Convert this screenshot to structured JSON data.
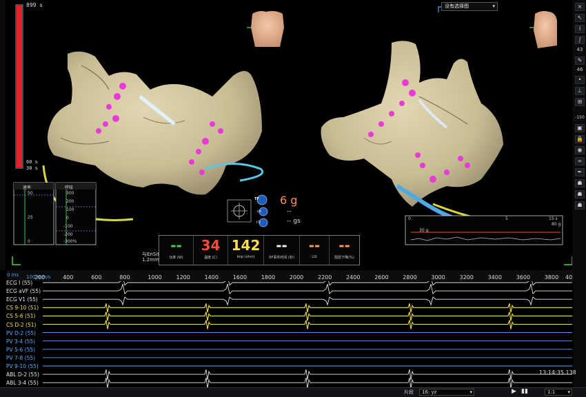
{
  "timer": {
    "value": "899 s",
    "sixty": "60 s",
    "thirty": "30 s"
  },
  "map_select": {
    "value": "没有选择图"
  },
  "zoom": {
    "value": "43"
  },
  "toolbar_numbers": {
    "n46": "46",
    "n150": "-150"
  },
  "resp_panel": {
    "title_left": "速率",
    "title_right": "呼吸",
    "left_ticks": [
      "50",
      "25",
      "0"
    ],
    "right_ticks": [
      "300",
      "200",
      "100",
      "0",
      "-100",
      "-200",
      "-300%"
    ]
  },
  "contact": {
    "force": "6 g",
    "dash1": "--",
    "dash2": "-- gs",
    "tf": "TF",
    "lm": "LM",
    "fti": "FTI"
  },
  "distance": {
    "line1": "与EnSite表面的距离",
    "line2": "1.2mm"
  },
  "rf": [
    {
      "value": "--",
      "caption": "功率 (W)",
      "color": "#4cd04c"
    },
    {
      "value": "34",
      "caption": "温度 (C)",
      "color": "#ff4a3a"
    },
    {
      "value": "142",
      "caption": "Imp (ohm)",
      "color": "#ffe04a"
    },
    {
      "value": "--",
      "caption": "RF事件时间 (秒)",
      "color": "#f0f0f0"
    },
    {
      "value": "--",
      "caption": "LSI",
      "color": "#ff9c5a"
    },
    {
      "value": "--",
      "caption": "阻抗下降(%)",
      "color": "#ff9c5a"
    }
  ],
  "inset": {
    "t0": "0",
    "t5": "5",
    "t15": "15 s",
    "g80": "80 g",
    "s30": "30 g"
  },
  "timeline": {
    "start": "0 ms",
    "ticks": [
      "100 mm/s",
      "200",
      "400",
      "600",
      "800",
      "1000",
      "1200",
      "1400",
      "1600",
      "1800",
      "2000",
      "2200",
      "2400",
      "2600",
      "2800",
      "3000",
      "3200",
      "3400",
      "3600",
      "3800",
      "40"
    ]
  },
  "channels": [
    {
      "name": "ECG I",
      "val": "(55)",
      "color": "#e6e6e6"
    },
    {
      "name": "ECG aVF",
      "val": "(55)",
      "color": "#e6e6e6"
    },
    {
      "name": "ECG V1",
      "val": "(55)",
      "color": "#e6e6e6"
    },
    {
      "name": "CS   9-10",
      "val": "(51)",
      "color": "#f2e04b"
    },
    {
      "name": "CS   5-6",
      "val": "(51)",
      "color": "#f2e04b"
    },
    {
      "name": "CS   D-2",
      "val": "(51)",
      "color": "#f2e04b"
    },
    {
      "name": "PV   D-2",
      "val": "(55)",
      "color": "#5aa8ff"
    },
    {
      "name": "PV   3-4",
      "val": "(55)",
      "color": "#5aa8ff"
    },
    {
      "name": "PV   5-6",
      "val": "(55)",
      "color": "#5aa8ff"
    },
    {
      "name": "PV   7-8",
      "val": "(55)",
      "color": "#5aa8ff"
    },
    {
      "name": "PV   9-10",
      "val": "(55)",
      "color": "#5aa8ff"
    },
    {
      "name": "ABL  D-2",
      "val": "(55)",
      "color": "#e6e6e6"
    },
    {
      "name": "ABL  3-4",
      "val": "(55)",
      "color": "#e6e6e6"
    }
  ],
  "clock": {
    "time": "13:14:35.138"
  },
  "bottom": {
    "segment_label": "片段",
    "segment_value": "16: yz",
    "ratio": "1:1"
  }
}
